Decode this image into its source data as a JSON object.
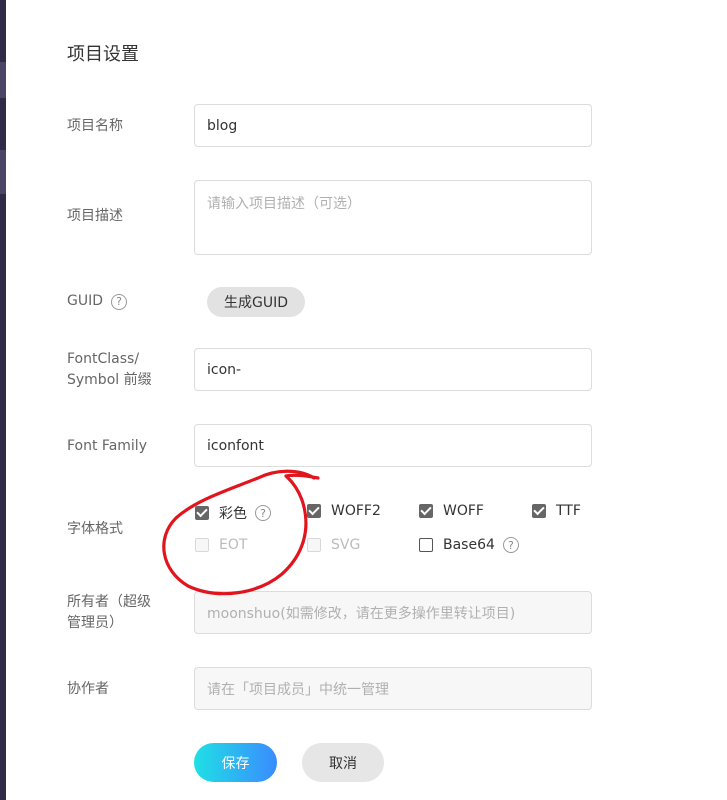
{
  "modal": {
    "title": "项目设置"
  },
  "form": {
    "name": {
      "label": "项目名称",
      "value": "blog"
    },
    "description": {
      "label": "项目描述",
      "placeholder": "请输入项目描述（可选）"
    },
    "guid": {
      "label": "GUID",
      "help": "?",
      "button": "生成GUID"
    },
    "prefix": {
      "label_line1": "FontClass/",
      "label_line2": "Symbol 前缀",
      "value": "icon-"
    },
    "font_family": {
      "label": "Font Family",
      "value": "iconfont"
    },
    "font_formats": {
      "label": "字体格式",
      "options": [
        {
          "label": "彩色",
          "checked": true,
          "disabled": false,
          "help": "?"
        },
        {
          "label": "WOFF2",
          "checked": true,
          "disabled": false
        },
        {
          "label": "WOFF",
          "checked": true,
          "disabled": false
        },
        {
          "label": "TTF",
          "checked": true,
          "disabled": false
        },
        {
          "label": "EOT",
          "checked": false,
          "disabled": true
        },
        {
          "label": "SVG",
          "checked": false,
          "disabled": true
        },
        {
          "label": "Base64",
          "checked": false,
          "disabled": false,
          "help": "?"
        }
      ]
    },
    "owner": {
      "label_line1": "所有者（超级",
      "label_line2": "管理员）",
      "placeholder": "moonshuo(如需修改，请在更多操作里转让项目)"
    },
    "collaborators": {
      "label": "协作者",
      "placeholder": "请在「项目成员」中统一管理"
    }
  },
  "actions": {
    "save": "保存",
    "cancel": "取消"
  },
  "colors": {
    "primary_gradient_start": "#1fe0e5",
    "primary_gradient_end": "#3a8bff",
    "annotation": "#e0151e"
  }
}
